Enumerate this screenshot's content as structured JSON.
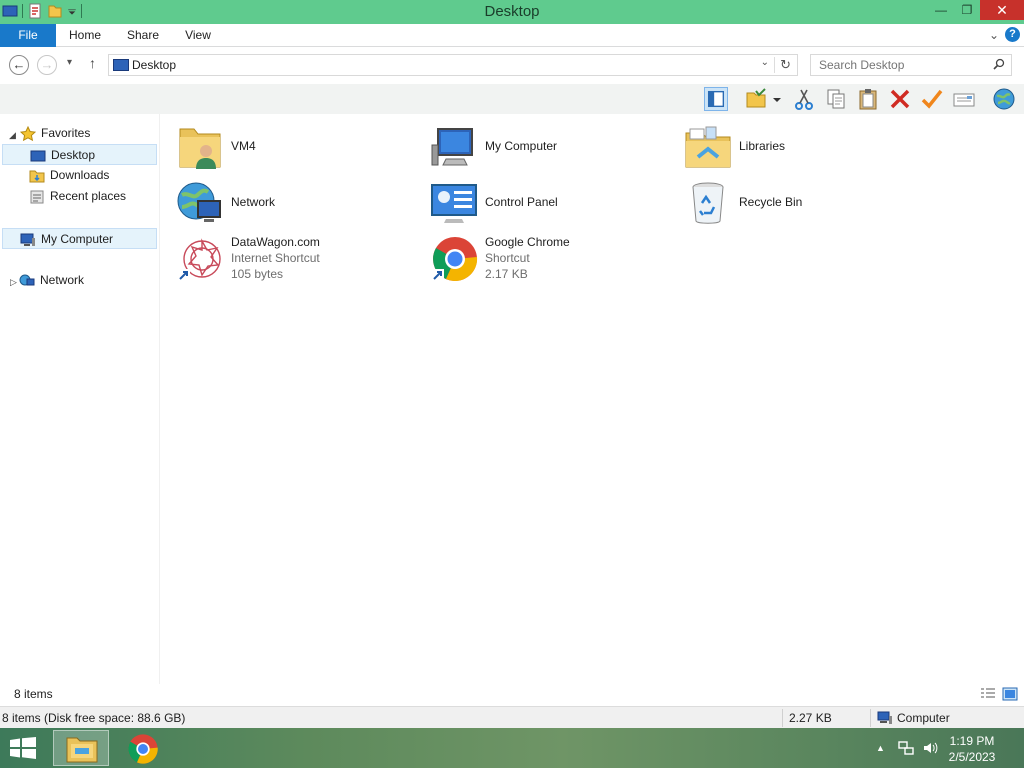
{
  "window": {
    "title": "Desktop",
    "controls": {
      "minimize": "—",
      "maximize": "❐",
      "close": "✕"
    }
  },
  "ribbon": {
    "tabs": [
      {
        "label": "File"
      },
      {
        "label": "Home"
      },
      {
        "label": "Share"
      },
      {
        "label": "View"
      }
    ],
    "expand": "⌄",
    "help": "?"
  },
  "address": {
    "path": "Desktop",
    "dropdown": "⌄",
    "refresh": "↻",
    "back": "←",
    "forward": "→",
    "recent": "▾",
    "up": "↑"
  },
  "search": {
    "placeholder": "Search Desktop"
  },
  "nav": {
    "favorites_label": "Favorites",
    "desktop_label": "Desktop",
    "downloads_label": "Downloads",
    "recent_label": "Recent places",
    "computer_label": "My Computer",
    "network_label": "Network"
  },
  "items": [
    {
      "name": "VM4",
      "icon": "user-folder-icon"
    },
    {
      "name": "My Computer",
      "icon": "computer-icon"
    },
    {
      "name": "Libraries",
      "icon": "libraries-icon"
    },
    {
      "name": "Network",
      "icon": "network-icon"
    },
    {
      "name": "Control Panel",
      "icon": "control-panel-icon"
    },
    {
      "name": "Recycle Bin",
      "icon": "recycle-bin-icon"
    },
    {
      "name": "DataWagon.com",
      "type": "Internet Shortcut",
      "size": "105 bytes",
      "icon": "internet-shortcut-icon"
    },
    {
      "name": "Google Chrome",
      "type": "Shortcut",
      "size": "2.17 KB",
      "icon": "chrome-icon"
    }
  ],
  "status": {
    "count": "8 items",
    "details": "8 items (Disk free space: 88.6 GB)",
    "size": "2.27 KB",
    "location": "Computer"
  },
  "taskbar": {
    "time": "1:19 PM",
    "date": "2/5/2023",
    "tray_arrow": "▲"
  },
  "colors": {
    "titlebar": "#5fcb8e",
    "file_tab": "#1979ca",
    "close": "#c7312b",
    "selection": "#e5f3fb"
  }
}
